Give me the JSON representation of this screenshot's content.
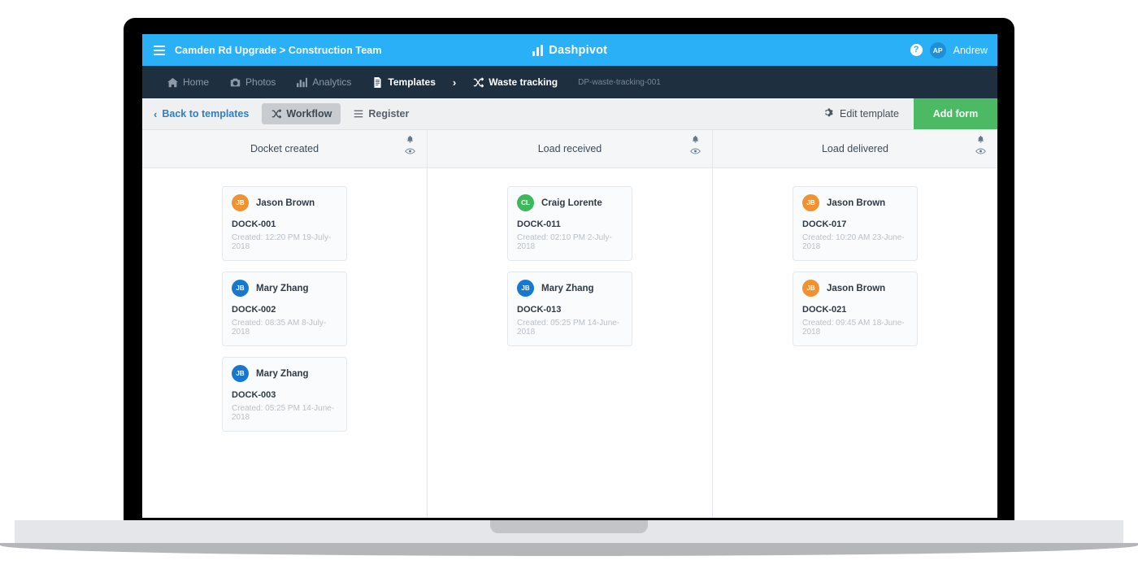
{
  "colors": {
    "topbar": "#29b0f7",
    "navbar": "#1e2f40",
    "toolbar": "#eef0f2",
    "accent_link": "#2f7fc1",
    "add_form_green": "#4cb964",
    "avatar_orange": "#f0922f",
    "avatar_blue": "#1878d0",
    "avatar_green": "#3cb95a"
  },
  "topbar": {
    "menu_icon": "hamburger-icon",
    "breadcrumb": "Camden Rd Upgrade > Construction Team",
    "brand": "Dashpivot",
    "brand_icon": "bar-chart-logo-icon",
    "help_icon": "?",
    "user_initials": "AP",
    "user_name": "Andrew"
  },
  "navbar": {
    "items": [
      {
        "label": "Home",
        "icon": "home-icon",
        "active": false
      },
      {
        "label": "Photos",
        "icon": "camera-icon",
        "active": false
      },
      {
        "label": "Analytics",
        "icon": "bar-chart-icon",
        "active": false
      },
      {
        "label": "Templates",
        "icon": "document-icon",
        "active": true
      }
    ],
    "separator": "›",
    "current": {
      "label": "Waste tracking",
      "icon": "shuffle-icon"
    },
    "code": "DP-waste-tracking-001"
  },
  "toolbar": {
    "back_label": "Back to templates",
    "back_icon": "chevron-left-icon",
    "tabs": [
      {
        "label": "Workflow",
        "icon": "shuffle-icon",
        "active": true
      },
      {
        "label": "Register",
        "icon": "list-icon",
        "active": false
      }
    ],
    "edit_template_label": "Edit template",
    "edit_template_icon": "gear-icon",
    "add_form_label": "Add form"
  },
  "board": {
    "column_actions": [
      "bell-icon",
      "eye-icon"
    ],
    "columns": [
      {
        "title": "Docket created",
        "cards": [
          {
            "initials": "JB",
            "avatar_color": "#f0922f",
            "user": "Jason Brown",
            "ref": "DOCK-001",
            "created": "Created: 12:20 PM 19-July-2018"
          },
          {
            "initials": "JB",
            "avatar_color": "#1878d0",
            "user": "Mary Zhang",
            "ref": "DOCK-002",
            "created": "Created: 08:35 AM 8-July-2018"
          },
          {
            "initials": "JB",
            "avatar_color": "#1878d0",
            "user": "Mary Zhang",
            "ref": "DOCK-003",
            "created": "Created: 05:25 PM 14-June-2018"
          }
        ]
      },
      {
        "title": "Load received",
        "cards": [
          {
            "initials": "CL",
            "avatar_color": "#3cb95a",
            "user": "Craig Lorente",
            "ref": "DOCK-011",
            "created": "Created: 02:10 PM 2-July-2018"
          },
          {
            "initials": "JB",
            "avatar_color": "#1878d0",
            "user": "Mary Zhang",
            "ref": "DOCK-013",
            "created": "Created: 05:25 PM 14-June-2018"
          }
        ]
      },
      {
        "title": "Load delivered",
        "cards": [
          {
            "initials": "JB",
            "avatar_color": "#f0922f",
            "user": "Jason Brown",
            "ref": "DOCK-017",
            "created": "Created: 10:20 AM 23-June-2018"
          },
          {
            "initials": "JB",
            "avatar_color": "#f0922f",
            "user": "Jason Brown",
            "ref": "DOCK-021",
            "created": "Created: 09:45 AM 18-June-2018"
          }
        ]
      }
    ]
  }
}
